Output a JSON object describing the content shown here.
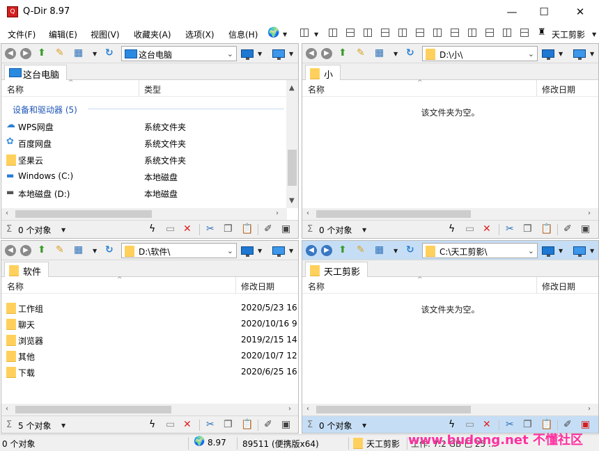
{
  "window": {
    "title": "Q-Dir 8.97",
    "minimize": "—",
    "maximize": "☐",
    "close": "✕"
  },
  "menu": {
    "items": [
      "文件(F)",
      "编辑(E)",
      "视图(V)",
      "收藏夹(A)",
      "选项(X)",
      "信息(H)"
    ],
    "right_label": "天工剪影"
  },
  "panes": [
    {
      "address": "这台电脑",
      "tab": "这台电脑",
      "columns": [
        "名称",
        "类型"
      ],
      "group": "设备和驱动器 (5)",
      "rows": [
        {
          "icon": "cloud-drive-icon",
          "name": "WPS网盘",
          "type": "系统文件夹"
        },
        {
          "icon": "baidu-cloud-icon",
          "name": "百度网盘",
          "type": "系统文件夹"
        },
        {
          "icon": "folder-icon",
          "name": "坚果云",
          "type": "系统文件夹"
        },
        {
          "icon": "windows-drive-icon",
          "name": "Windows (C:)",
          "type": "本地磁盘"
        },
        {
          "icon": "hard-drive-icon",
          "name": "本地磁盘 (D:)",
          "type": "本地磁盘"
        }
      ],
      "status": "0 个对象"
    },
    {
      "address": "D:\\小\\",
      "tab": "小",
      "columns": [
        "名称",
        "修改日期"
      ],
      "empty": "该文件夹为空。",
      "status": "0 个对象"
    },
    {
      "address": "D:\\软件\\",
      "tab": "软件",
      "columns": [
        "名称",
        "修改日期"
      ],
      "rows": [
        {
          "name": "工作组",
          "date": "2020/5/23 16"
        },
        {
          "name": "聊天",
          "date": "2020/10/16 9"
        },
        {
          "name": "浏览器",
          "date": "2019/2/15 14"
        },
        {
          "name": "其他",
          "date": "2020/10/7 12"
        },
        {
          "name": "下载",
          "date": "2020/6/25 16"
        }
      ],
      "status": "5 个对象"
    },
    {
      "address": "C:\\天工剪影\\",
      "tab": "天工剪影",
      "columns": [
        "名称",
        "修改日期"
      ],
      "empty": "该文件夹为空。",
      "status": "0 个对象"
    }
  ],
  "statusbar": {
    "objects": "0 个对象",
    "version": "8.97",
    "build": "89511 (便携版x64)",
    "folder": "天工剪影",
    "partial": "工作: 7.2 GB 已 25 ..."
  },
  "watermark": "www.budong.net 不懂社区",
  "colors": {
    "active_pane": "#c6def5",
    "group_header": "#1f55b6",
    "folder": "#ffd15c",
    "watermark": "#ff2fa0"
  }
}
